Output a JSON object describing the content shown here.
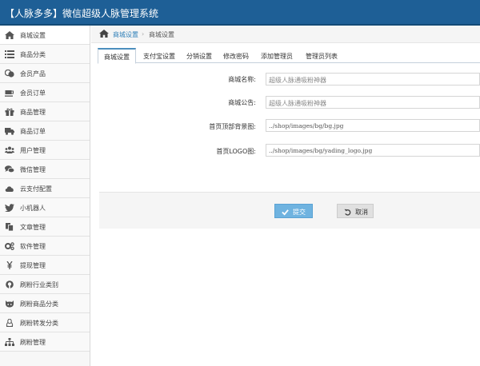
{
  "app": {
    "title": "【人脉多多】微信超级人脉管理系统"
  },
  "sidebar": {
    "items": [
      {
        "label": "商城设置",
        "icon": "home-icon"
      },
      {
        "label": "商品分类",
        "icon": "list-icon"
      },
      {
        "label": "会员产品",
        "icon": "coins-icon"
      },
      {
        "label": "会员订单",
        "icon": "coffee-icon"
      },
      {
        "label": "商品管理",
        "icon": "gift-icon"
      },
      {
        "label": "商品订单",
        "icon": "truck-icon"
      },
      {
        "label": "用户管理",
        "icon": "users-icon"
      },
      {
        "label": "微信管理",
        "icon": "comments-icon"
      },
      {
        "label": "云支付配置",
        "icon": "cloud-icon"
      },
      {
        "label": "小机器人",
        "icon": "twitter-icon"
      },
      {
        "label": "文章管理",
        "icon": "copy-icon"
      },
      {
        "label": "软件管理",
        "icon": "cogs-icon"
      },
      {
        "label": "提现管理",
        "icon": "yen-icon"
      },
      {
        "label": "刷粉行业类别",
        "icon": "github-icon"
      },
      {
        "label": "刷粉商品分类",
        "icon": "github-alt-icon"
      },
      {
        "label": "刷粉转发分类",
        "icon": "linux-icon"
      },
      {
        "label": "刷粉管理",
        "icon": "sitemap-icon"
      }
    ]
  },
  "breadcrumb": {
    "parent": "商城设置",
    "current": "商城设置",
    "separator": "›"
  },
  "tabs": [
    {
      "label": "商城设置",
      "active": true
    },
    {
      "label": "支付宝设置",
      "active": false
    },
    {
      "label": "分销设置",
      "active": false
    },
    {
      "label": "修改密码",
      "active": false
    },
    {
      "label": "添加管理员",
      "active": false
    },
    {
      "label": "管理员列表",
      "active": false
    }
  ],
  "form": {
    "shop_name": {
      "label": "商城名称:",
      "value": "超级人脉通吸粉神器"
    },
    "shop_notice": {
      "label": "商城公告:",
      "value": "超级人脉通吸粉神器"
    },
    "home_bg": {
      "label": "首页顶部背景图:",
      "value": "../shop/images/bg/bg.jpg"
    },
    "home_logo": {
      "label": "首页LOGO图:",
      "value": "../shop/images/bg/yading_logo.jpg"
    }
  },
  "actions": {
    "submit_label": "提交",
    "cancel_label": "取消"
  },
  "colors": {
    "header": "#1e5f96",
    "accent": "#2e7fb8",
    "submit": "#6fb3e0"
  }
}
